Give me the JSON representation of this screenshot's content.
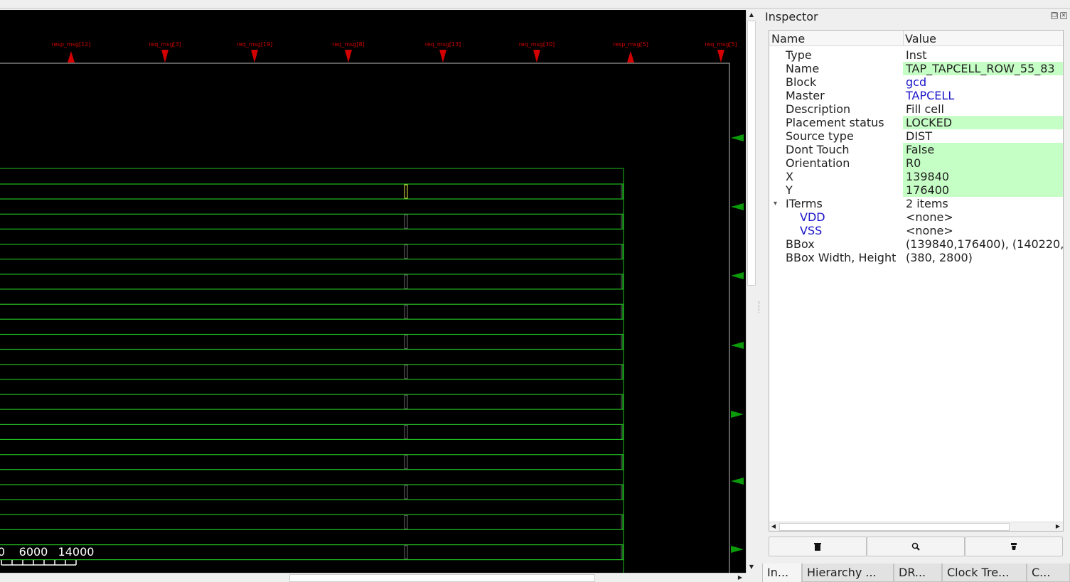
{
  "layout": {
    "pins_top": [
      {
        "label": "resp_msg[12]",
        "dir": "up"
      },
      {
        "label": "req_msg[3]",
        "dir": "down"
      },
      {
        "label": "req_msg[19]",
        "dir": "down"
      },
      {
        "label": "req_msg[8]",
        "dir": "down"
      },
      {
        "label": "req_msg[13]",
        "dir": "down"
      },
      {
        "label": "req_msg[30]",
        "dir": "down"
      },
      {
        "label": "resp_msg[5]",
        "dir": "up"
      },
      {
        "label": "req_msg[5]",
        "dir": "down"
      }
    ],
    "scale_labels": [
      "0",
      "6000",
      "14000"
    ],
    "colors": {
      "background": "#000000",
      "pin": "#d40000",
      "row": "#22bb22",
      "selected": "#e8e84a",
      "right_pins": "#0a9a0a"
    }
  },
  "inspector": {
    "title": "Inspector",
    "columns": {
      "name": "Name",
      "value": "Value"
    },
    "rows": [
      {
        "name": "Type",
        "value": "Inst",
        "style": "plain"
      },
      {
        "name": "Name",
        "value": "TAP_TAPCELL_ROW_55_83",
        "style": "editable"
      },
      {
        "name": "Block",
        "value": "gcd",
        "style": "link"
      },
      {
        "name": "Master",
        "value": "TAPCELL",
        "style": "link"
      },
      {
        "name": "Description",
        "value": "Fill cell",
        "style": "plain"
      },
      {
        "name": "Placement status",
        "value": "LOCKED",
        "style": "editable"
      },
      {
        "name": "Source type",
        "value": "DIST",
        "style": "plain"
      },
      {
        "name": "Dont Touch",
        "value": "False",
        "style": "editable"
      },
      {
        "name": "Orientation",
        "value": "R0",
        "style": "editable"
      },
      {
        "name": "X",
        "value": "139840",
        "style": "editable"
      },
      {
        "name": "Y",
        "value": "176400",
        "style": "editable"
      },
      {
        "name": "ITerms",
        "value": "2 items",
        "style": "plain",
        "expanded": true
      },
      {
        "name": "VDD",
        "value": "<none>",
        "style": "plain",
        "child": true
      },
      {
        "name": "VSS",
        "value": "<none>",
        "style": "plain",
        "child": true
      },
      {
        "name": "BBox",
        "value": "(139840,176400), (140220,",
        "style": "plain"
      },
      {
        "name": "BBox Width, Height",
        "value": "(380, 2800)",
        "style": "plain"
      }
    ],
    "buttons": [
      {
        "icon": "trash-icon"
      },
      {
        "icon": "zoom-icon"
      },
      {
        "icon": "highlight-icon"
      }
    ],
    "tabs": [
      "In...",
      "Hierarchy ...",
      "DR...",
      "Clock Tre...",
      "C..."
    ],
    "accent": "#c6ffc6",
    "link_color": "#1a14c8"
  }
}
